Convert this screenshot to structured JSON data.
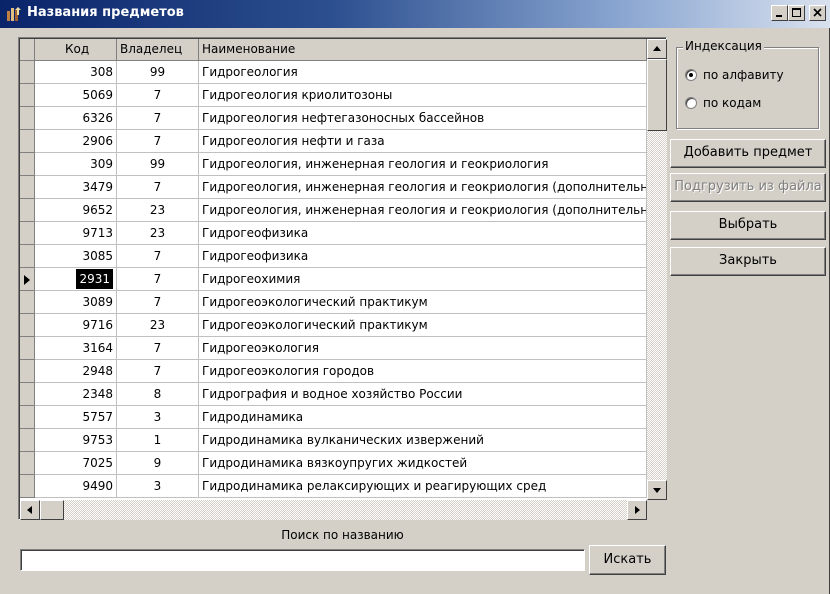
{
  "window": {
    "title": "Названия предметов"
  },
  "columns": {
    "code": "Код",
    "owner": "Владелец",
    "name": "Наименование"
  },
  "rows": [
    {
      "code": "308",
      "owner": "99",
      "name": "Гидрогеология"
    },
    {
      "code": "5069",
      "owner": "7",
      "name": "Гидрогеология криолитозоны"
    },
    {
      "code": "6326",
      "owner": "7",
      "name": "Гидрогеология нефтегазоносных бассейнов"
    },
    {
      "code": "2906",
      "owner": "7",
      "name": "Гидрогеология нефти и газа"
    },
    {
      "code": "309",
      "owner": "99",
      "name": "Гидрогеология, инженерная геология и геокриология"
    },
    {
      "code": "3479",
      "owner": "7",
      "name": "Гидрогеология, инженерная геология и геокриология (дополнительны"
    },
    {
      "code": "9652",
      "owner": "23",
      "name": "Гидрогеология, инженерная геология и геокриология (дополнительны"
    },
    {
      "code": "9713",
      "owner": "23",
      "name": "Гидрогеофизика"
    },
    {
      "code": "3085",
      "owner": "7",
      "name": "Гидрогеофизика"
    },
    {
      "code": "2931",
      "owner": "7",
      "name": "Гидрогеохимия",
      "selected": true
    },
    {
      "code": "3089",
      "owner": "7",
      "name": "Гидрогеоэкологический практикум"
    },
    {
      "code": "9716",
      "owner": "23",
      "name": "Гидрогеоэкологический практикум"
    },
    {
      "code": "3164",
      "owner": "7",
      "name": "Гидрогеоэкология"
    },
    {
      "code": "2948",
      "owner": "7",
      "name": "Гидрогеоэкология городов"
    },
    {
      "code": "2348",
      "owner": "8",
      "name": "Гидрография и водное хозяйство России"
    },
    {
      "code": "5757",
      "owner": "3",
      "name": "Гидродинамика"
    },
    {
      "code": "9753",
      "owner": "1",
      "name": "Гидродинамика вулканических извержений"
    },
    {
      "code": "7025",
      "owner": "9",
      "name": "Гидродинамика вязкоупругих жидкостей"
    },
    {
      "code": "9490",
      "owner": "3",
      "name": "Гидродинамика релаксирующих и реагирующих сред"
    }
  ],
  "indexing": {
    "title": "Индексация",
    "options": [
      {
        "label": "по алфавиту",
        "checked": true
      },
      {
        "label": "по кодам",
        "checked": false
      }
    ]
  },
  "buttons": {
    "add": "Добавить предмет",
    "load": "Подгрузить из файла",
    "select": "Выбрать",
    "close": "Закрыть",
    "search": "Искать"
  },
  "search": {
    "label": "Поиск по названию",
    "value": ""
  }
}
